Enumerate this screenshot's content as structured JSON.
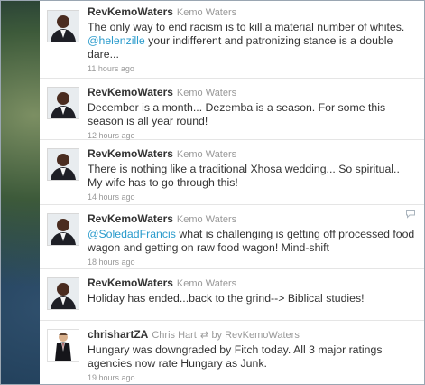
{
  "tweets": [
    {
      "screen_name": "RevKemoWaters",
      "full_name": "Kemo Waters",
      "text_parts": {
        "a": "The only way to end racism is to kill a material number of whites. ",
        "mention": "@helenzille",
        "b": " your indifferent and patronizing stance is a double dare..."
      },
      "time": "11 hours ago"
    },
    {
      "screen_name": "RevKemoWaters",
      "full_name": "Kemo Waters",
      "text": "December is a month... Dezemba is a season. For some this season is all year round!",
      "time": "12 hours ago"
    },
    {
      "screen_name": "RevKemoWaters",
      "full_name": "Kemo Waters",
      "text": "There is nothing like a traditional Xhosa wedding... So spiritual.. My wife has to go through this!",
      "time": "14 hours ago"
    },
    {
      "screen_name": "RevKemoWaters",
      "full_name": "Kemo Waters",
      "text_parts": {
        "mention": "@SoledadFrancis",
        "b": " what is challenging is getting off processed food wagon and getting on raw food wagon! Mind-shift"
      },
      "time": "18 hours ago",
      "reply_icon": "reply-icon"
    },
    {
      "screen_name": "RevKemoWaters",
      "full_name": "Kemo Waters",
      "text": "Holiday has ended...back to the grind--> Biblical studies!",
      "time": "18 hours ago"
    },
    {
      "screen_name": "chrishartZA",
      "full_name": "Chris Hart",
      "retweet_icon": "retweet-icon",
      "retweet_by": "by RevKemoWaters",
      "text": "Hungary was downgraded by Fitch today. All 3 major ratings agencies now rate Hungary as Junk.",
      "time": "19 hours ago"
    }
  ],
  "colors": {
    "mention": "#2a9bcc",
    "screen_name": "#333333",
    "meta": "#999999"
  }
}
